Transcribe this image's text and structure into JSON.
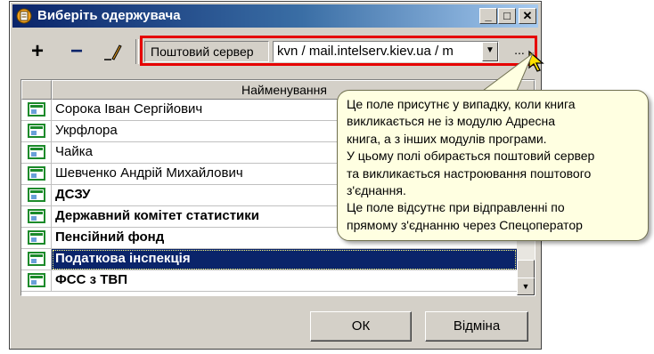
{
  "window": {
    "title": "Виберіть одержувача",
    "controls": {
      "minimize": "_",
      "maximize": "□",
      "close": "✕"
    }
  },
  "toolbar": {
    "add": "+",
    "remove": "−",
    "edit": "pencil-icon",
    "server_label": "Поштовий сервер",
    "server_value": "kvn / mail.intelserv.kiev.ua / m",
    "browse": "..."
  },
  "grid": {
    "column_header": "Найменування",
    "rows": [
      {
        "name": "Сорока Іван Сергійович",
        "bold": false,
        "selected": false
      },
      {
        "name": "Укрфлора",
        "bold": false,
        "selected": false
      },
      {
        "name": "Чайка",
        "bold": false,
        "selected": false
      },
      {
        "name": "Шевченко Андрій Михайлович",
        "bold": false,
        "selected": false
      },
      {
        "name": "ДСЗУ",
        "bold": true,
        "selected": false
      },
      {
        "name": "Державний комітет статистики",
        "bold": true,
        "selected": false
      },
      {
        "name": "Пенсійний фонд",
        "bold": true,
        "selected": false
      },
      {
        "name": "Податкова інспекція",
        "bold": true,
        "selected": true
      },
      {
        "name": "ФСС з ТВП",
        "bold": true,
        "selected": false
      }
    ]
  },
  "buttons": {
    "ok": "ОК",
    "cancel": "Відміна"
  },
  "tooltip": {
    "lines": [
      "Це поле присутнє у випадку, коли книга",
      "викликається не із модулю Адресна",
      "книга, а з інших модулів програми.",
      "У цьому полі обирається поштовий сервер",
      "та викликається настроювання поштового",
      "з'єднання.",
      "Це поле відсутнє при відправленні по",
      "прямому з'єднанню через Спецоператор"
    ]
  },
  "colors": {
    "selection": "#0a246a",
    "highlight_frame": "#e60000",
    "tooltip_bg": "#ffffe1"
  }
}
